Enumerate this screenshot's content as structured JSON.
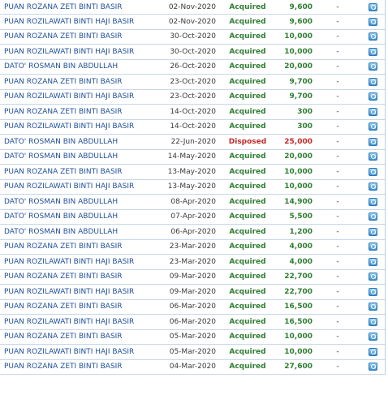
{
  "rows": [
    {
      "name": "PUAN ROZANA ZETI BINTI BASIR",
      "date": "02-Nov-2020",
      "type": "Acquired",
      "amount": "9,600",
      "dash": "-"
    },
    {
      "name": "PUAN ROZILAWATI BINTI HAJI BASIR",
      "date": "02-Nov-2020",
      "type": "Acquired",
      "amount": "9,600",
      "dash": "-"
    },
    {
      "name": "PUAN ROZANA ZETI BINTI BASIR",
      "date": "30-Oct-2020",
      "type": "Acquired",
      "amount": "10,000",
      "dash": "-"
    },
    {
      "name": "PUAN ROZILAWATI BINTI HAJI BASIR",
      "date": "30-Oct-2020",
      "type": "Acquired",
      "amount": "10,000",
      "dash": "-"
    },
    {
      "name": "DATO' ROSMAN BIN ABDULLAH",
      "date": "26-Oct-2020",
      "type": "Acquired",
      "amount": "20,000",
      "dash": "-"
    },
    {
      "name": "PUAN ROZANA ZETI BINTI BASIR",
      "date": "23-Oct-2020",
      "type": "Acquired",
      "amount": "9,700",
      "dash": "-"
    },
    {
      "name": "PUAN ROZILAWATI BINTI HAJI BASIR",
      "date": "23-Oct-2020",
      "type": "Acquired",
      "amount": "9,700",
      "dash": "-"
    },
    {
      "name": "PUAN ROZANA ZETI BINTI BASIR",
      "date": "14-Oct-2020",
      "type": "Acquired",
      "amount": "300",
      "dash": "-"
    },
    {
      "name": "PUAN ROZILAWATI BINTI HAJI BASIR",
      "date": "14-Oct-2020",
      "type": "Acquired",
      "amount": "300",
      "dash": "-"
    },
    {
      "name": "DATO' ROSMAN BIN ABDULLAH",
      "date": "22-Jun-2020",
      "type": "Disposed",
      "amount": "25,000",
      "dash": "-"
    },
    {
      "name": "DATO' ROSMAN BIN ABDULLAH",
      "date": "14-May-2020",
      "type": "Acquired",
      "amount": "20,000",
      "dash": "-"
    },
    {
      "name": "PUAN ROZANA ZETI BINTI BASIR",
      "date": "13-May-2020",
      "type": "Acquired",
      "amount": "10,000",
      "dash": "-"
    },
    {
      "name": "PUAN ROZILAWATI BINTI HAJI BASIR",
      "date": "13-May-2020",
      "type": "Acquired",
      "amount": "10,000",
      "dash": "-"
    },
    {
      "name": "DATO' ROSMAN BIN ABDULLAH",
      "date": "08-Apr-2020",
      "type": "Acquired",
      "amount": "14,900",
      "dash": "-"
    },
    {
      "name": "DATO' ROSMAN BIN ABDULLAH",
      "date": "07-Apr-2020",
      "type": "Acquired",
      "amount": "5,500",
      "dash": "-"
    },
    {
      "name": "DATO' ROSMAN BIN ABDULLAH",
      "date": "06-Apr-2020",
      "type": "Acquired",
      "amount": "1,200",
      "dash": "-"
    },
    {
      "name": "PUAN ROZANA ZETI BINTI BASIR",
      "date": "23-Mar-2020",
      "type": "Acquired",
      "amount": "4,000",
      "dash": "-"
    },
    {
      "name": "PUAN ROZILAWATI BINTI HAJI BASIR",
      "date": "23-Mar-2020",
      "type": "Acquired",
      "amount": "4,000",
      "dash": "-"
    },
    {
      "name": "PUAN ROZANA ZETI BINTI BASIR",
      "date": "09-Mar-2020",
      "type": "Acquired",
      "amount": "22,700",
      "dash": "-"
    },
    {
      "name": "PUAN ROZILAWATI BINTI HAJI BASIR",
      "date": "09-Mar-2020",
      "type": "Acquired",
      "amount": "22,700",
      "dash": "-"
    },
    {
      "name": "PUAN ROZANA ZETI BINTI BASIR",
      "date": "06-Mar-2020",
      "type": "Acquired",
      "amount": "16,500",
      "dash": "-"
    },
    {
      "name": "PUAN ROZILAWATI BINTI HAJI BASIR",
      "date": "06-Mar-2020",
      "type": "Acquired",
      "amount": "16,500",
      "dash": "-"
    },
    {
      "name": "PUAN ROZANA ZETI BINTI BASIR",
      "date": "05-Mar-2020",
      "type": "Acquired",
      "amount": "10,000",
      "dash": "-"
    },
    {
      "name": "PUAN ROZILAWATI BINTI HAJI BASIR",
      "date": "05-Mar-2020",
      "type": "Acquired",
      "amount": "10,000",
      "dash": "-"
    },
    {
      "name": "PUAN ROZANA ZETI BINTI BASIR",
      "date": "04-Mar-2020",
      "type": "Acquired",
      "amount": "27,600",
      "dash": "-"
    }
  ],
  "icon": "magnifier-icon",
  "colors": {
    "name_link": "#1f4e9a",
    "acquired": "#2f7d32",
    "disposed": "#c62828",
    "row_border": "#c7d7ea"
  }
}
